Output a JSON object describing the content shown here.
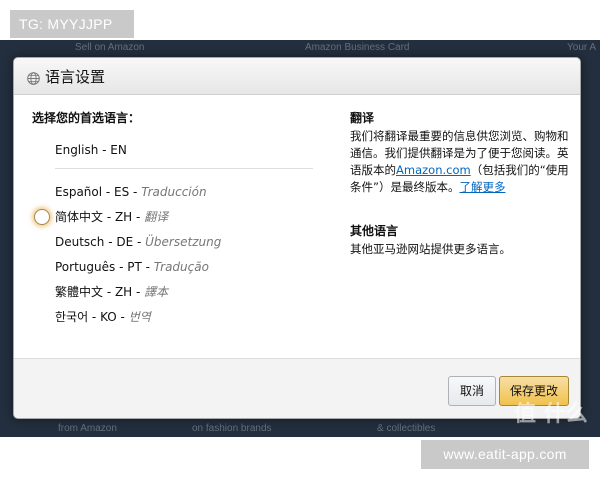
{
  "watermark": {
    "top_tag": "TG: MYYJJPP",
    "bottom_tag": "www.eatit-app.com",
    "logo_text": "值 什么"
  },
  "background": {
    "top_links": [
      "Sell on Amazon",
      "Amazon Business Card",
      "Your A"
    ],
    "bottom_links": [
      "from Amazon",
      "on fashion brands",
      "& collectibles"
    ]
  },
  "dialog": {
    "title": "语言设置",
    "title_icon": "globe-icon",
    "prompt": "选择您的首选语言：",
    "default_language": "English - EN",
    "languages": [
      {
        "label": "Español - ES - ",
        "translation": "Traducción"
      },
      {
        "label": "简体中文 - ZH - ",
        "translation": "翻译",
        "selected": true
      },
      {
        "label": "Deutsch - DE - ",
        "translation": "Übersetzung"
      },
      {
        "label": "Português - PT - ",
        "translation": "Tradução"
      },
      {
        "label": "繁體中文 - ZH - ",
        "translation": "譯本"
      },
      {
        "label": "한국어 - KO - ",
        "translation": "번역"
      }
    ],
    "translation_info": {
      "heading": "翻译",
      "text_before_link": "我们将翻译最重要的信息供您浏览、购物和通信。我们提供翻译是为了便于您阅读。英语版本的",
      "link_amazon": "Amazon.com",
      "text_after_link": "（包括我们的“使用条件”）是最终版本。",
      "learn_more": "了解更多"
    },
    "other_languages": {
      "heading": "其他语言",
      "text": "其他亚马逊网站提供更多语言。"
    },
    "buttons": {
      "cancel": "取消",
      "save": "保存更改"
    }
  },
  "colors": {
    "backdrop": "#232f3e",
    "link": "#0066c0",
    "save_button": "#f0c14b",
    "radio_focus": "#e6a028"
  }
}
